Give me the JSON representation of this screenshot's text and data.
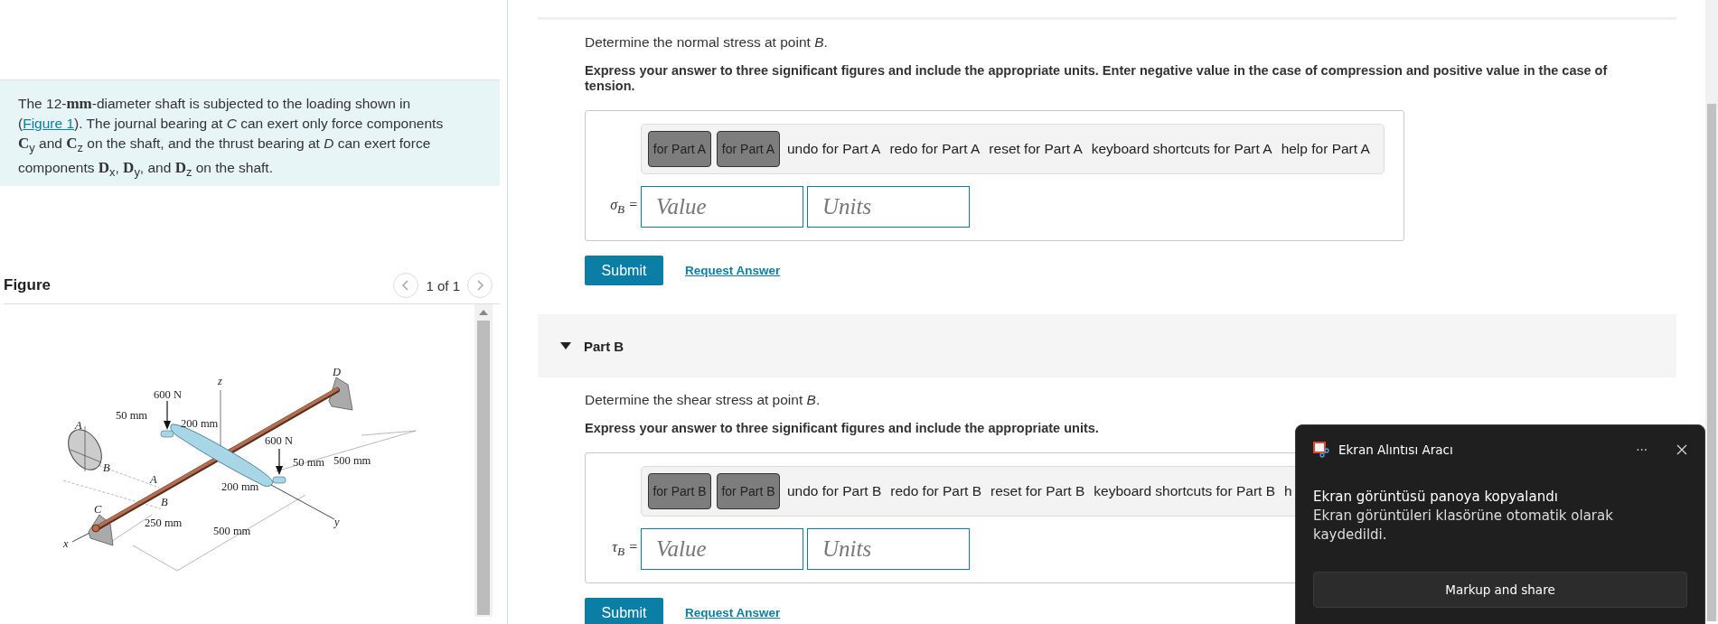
{
  "problem": {
    "text_before": "The 12-**mm**-diameter shaft is subjected to the loading shown in (",
    "link": "Figure 1",
    "text_after": "). The journal bearing at *C* can exert only force components **C**$_{y}$ and **C**$_{z}$ on the shaft, and the thrust bearing at *D* can exert force components **D**$_{x}$, **D**$_{y}$, and **D**$_{z}$ on the shaft."
  },
  "figure": {
    "title": "Figure",
    "pager": "1 of 1",
    "labels": [
      {
        "text": "600 N"
      },
      {
        "text": "50 mm"
      },
      {
        "text": "200 mm"
      },
      {
        "text": "z"
      },
      {
        "text": "D"
      },
      {
        "text": "A"
      },
      {
        "text": "B"
      },
      {
        "text": "600 N"
      },
      {
        "text": "50 mm"
      },
      {
        "text": "500 mm"
      },
      {
        "text": "A"
      },
      {
        "text": "200 mm"
      },
      {
        "text": "B"
      },
      {
        "text": "C"
      },
      {
        "text": "250 mm"
      },
      {
        "text": "500 mm"
      },
      {
        "text": "x"
      },
      {
        "text": "y"
      }
    ]
  },
  "parts": [
    {
      "prompt": "Determine the normal stress at point *B*.",
      "instruction": "Express your answer to three significant figures and include the appropriate units. Enter negative value in the case of compression and positive value in the case of tension.",
      "toolbar": [
        {
          "kind": "tool",
          "label": "for Part A"
        },
        {
          "kind": "tool",
          "label": "for Part A"
        },
        {
          "kind": "link",
          "label": "undo for Part A"
        },
        {
          "kind": "link",
          "label": "redo for Part A"
        },
        {
          "kind": "link",
          "label": "reset for Part A"
        },
        {
          "kind": "link",
          "label": "keyboard shortcuts for Part A"
        },
        {
          "kind": "link",
          "label": "help for Part A"
        }
      ],
      "symbol": "σ$_{B}$ =",
      "value_placeholder": "Value",
      "units_placeholder": "Units",
      "submit": "Submit",
      "request": "Request Answer"
    },
    {
      "title": "Part B",
      "expanded": true,
      "prompt": "Determine the shear stress at point *B*.",
      "instruction": "Express your answer to three significant figures and include the appropriate units.",
      "toolbar": [
        {
          "kind": "tool",
          "label": "for Part B"
        },
        {
          "kind": "tool",
          "label": "for Part B"
        },
        {
          "kind": "link",
          "label": "undo for Part B"
        },
        {
          "kind": "link",
          "label": "redo for Part B"
        },
        {
          "kind": "link",
          "label": "reset for Part B"
        },
        {
          "kind": "link",
          "label": "keyboard shortcuts for Part B"
        },
        {
          "kind": "link",
          "label": "h"
        }
      ],
      "symbol": "τ$_{B}$ =",
      "value_placeholder": "Value",
      "units_placeholder": "Units",
      "submit": "Submit",
      "request": "Request Answer"
    }
  ],
  "toast": {
    "app": "Ekran Alıntısı Aracı",
    "more": "···",
    "title": "Ekran görüntüsü panoya kopyalandı",
    "body": "Ekran görüntüleri klasörüne otomatik olarak kaydedildi.",
    "button": "Markup and share"
  }
}
